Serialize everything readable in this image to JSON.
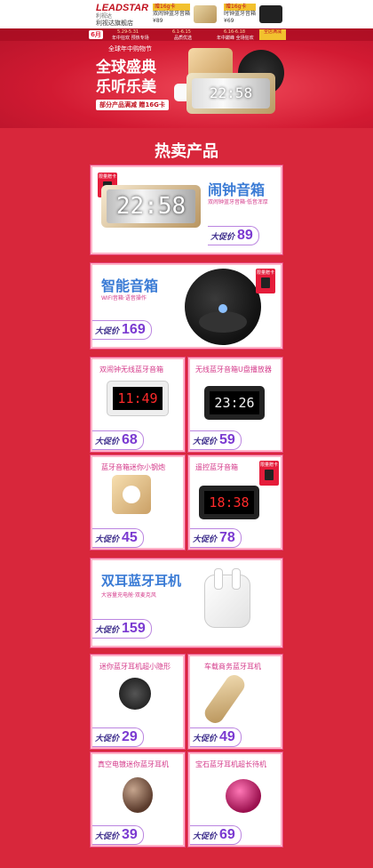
{
  "topbar": {
    "brand": "LEADSTAR",
    "brand_sub": "利视达",
    "store_name": "利视达旗舰店",
    "promo1": {
      "badge": "赠16g卡",
      "label": "双闹钟蓝牙音箱",
      "price_note": "¥89"
    },
    "promo2": {
      "badge": "赠16g卡",
      "label": "时钟蓝牙音箱",
      "price_note": "¥69"
    }
  },
  "hero": {
    "date": "6月",
    "nav": [
      {
        "date": "5.29-5.31",
        "label": "年中狂欢 预热专场"
      },
      {
        "date": "6.1-6.15",
        "label": "品质优选"
      },
      {
        "date": "6.16-6.18",
        "label": "年中巅峰 全场狂欢"
      }
    ],
    "full_button": "全店满减",
    "top_small": "全球年中购物节",
    "line1": "全球盛典",
    "line2": "乐听乐美",
    "promo_prefix": "部分产品满减 赠",
    "promo_highlight": "16G卡",
    "clock_time": "22:58"
  },
  "section_title": "热卖产品",
  "price_prefix": "大促价",
  "tag_text": "限量赠卡",
  "products": [
    {
      "title": "闹钟音箱",
      "sub": "双闹钟蓝牙音箱·低音浑厚",
      "price": "89",
      "time": "22:58"
    },
    {
      "title": "智能音箱",
      "sub": "WIFI音箱·语音操作",
      "price": "169"
    },
    {
      "title": "双闹钟无线蓝牙音箱",
      "price": "68",
      "time": "11:49"
    },
    {
      "title": "无线蓝牙音箱U盘播放器",
      "price": "59",
      "time": "23:26"
    },
    {
      "title": "蓝牙音箱迷你小钢炮",
      "price": "45"
    },
    {
      "title": "遥控蓝牙音箱",
      "price": "78",
      "time": "18:38"
    },
    {
      "title": "双耳蓝牙耳机",
      "sub": "大容量充电舱·双麦克风",
      "price": "159"
    },
    {
      "title": "迷你蓝牙耳机超小隐形",
      "price": "29"
    },
    {
      "title": "车载商务蓝牙耳机",
      "price": "49"
    },
    {
      "title": "真空电镀迷你蓝牙耳机",
      "price": "39"
    },
    {
      "title": "宝石蓝牙耳机超长待机",
      "price": "69"
    }
  ]
}
